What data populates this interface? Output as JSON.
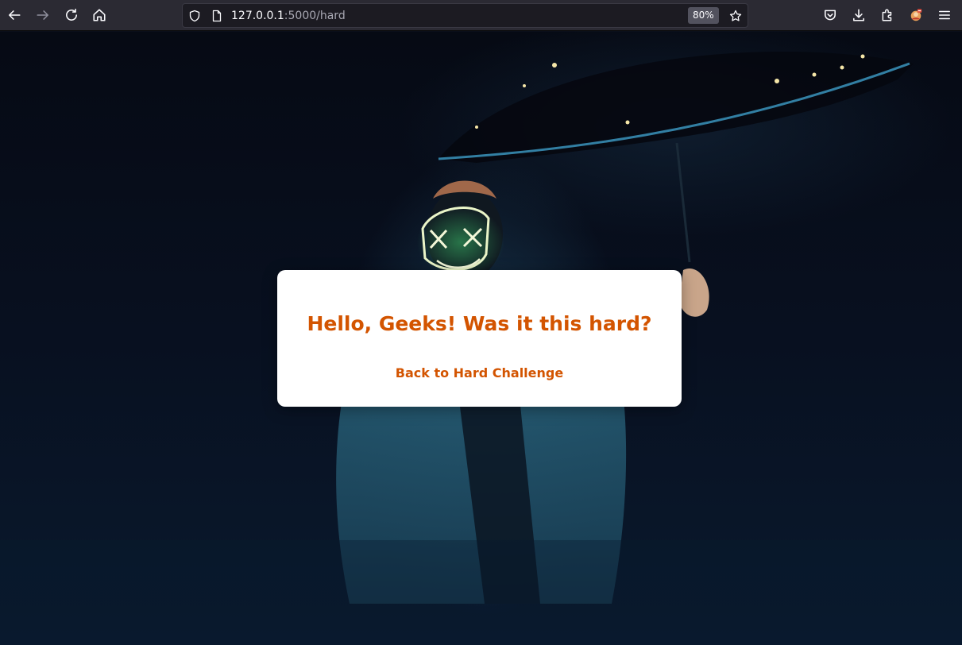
{
  "browser": {
    "url_host": "127.0.0.1",
    "url_rest": ":5000/hard",
    "zoom": "80%"
  },
  "page": {
    "heading": "Hello, Geeks! Was it this hard?",
    "back_link": "Back to Hard Challenge"
  },
  "colors": {
    "accent": "#d35400",
    "card_bg": "#ffffff",
    "chrome_bg": "#2b2a33"
  },
  "icons": [
    "back-icon",
    "forward-icon",
    "reload-icon",
    "home-icon",
    "shield-icon",
    "page-icon",
    "star-icon",
    "pocket-icon",
    "download-icon",
    "extensions-icon",
    "account-icon",
    "menu-icon"
  ]
}
